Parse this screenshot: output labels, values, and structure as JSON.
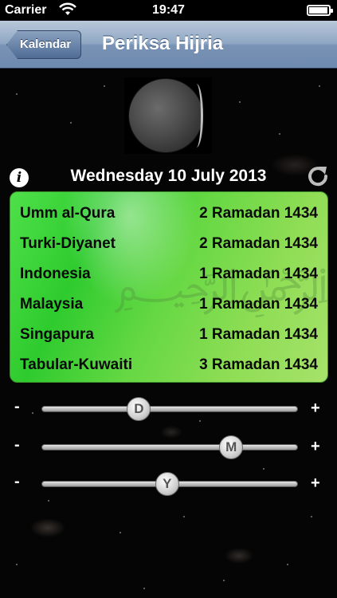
{
  "status_bar": {
    "carrier": "Carrier",
    "time": "19:47",
    "wifi_icon": "wifi-icon",
    "battery_icon": "battery-icon"
  },
  "nav": {
    "back_label": "Kalendar",
    "title": "Periksa Hijria"
  },
  "main": {
    "date_heading": "Wednesday 10 July 2013",
    "info_icon": "info-icon",
    "refresh_icon": "refresh-icon",
    "moon_icon": "moon-phase-icon",
    "hijri_rows": [
      {
        "name": "Umm al-Qura",
        "date": "2 Ramadan 1434"
      },
      {
        "name": "Turki-Diyanet",
        "date": "2 Ramadan 1434"
      },
      {
        "name": "Indonesia",
        "date": "1 Ramadan 1434"
      },
      {
        "name": "Malaysia",
        "date": "1 Ramadan 1434"
      },
      {
        "name": "Singapura",
        "date": "1 Ramadan 1434"
      },
      {
        "name": "Tabular-Kuwaiti",
        "date": "3 Ramadan 1434"
      }
    ]
  },
  "sliders": [
    {
      "minus": "-",
      "plus": "+",
      "knob": "D",
      "level": 0.38
    },
    {
      "minus": "-",
      "plus": "+",
      "knob": "M",
      "level": 0.74
    },
    {
      "minus": "-",
      "plus": "+",
      "knob": "Y",
      "level": 0.49
    }
  ],
  "colors": {
    "nav_gradient_top": "#b9c8da",
    "nav_gradient_bottom": "#6d89ad",
    "card_green": "#4fe04a",
    "card_lime": "#a6e26a"
  }
}
